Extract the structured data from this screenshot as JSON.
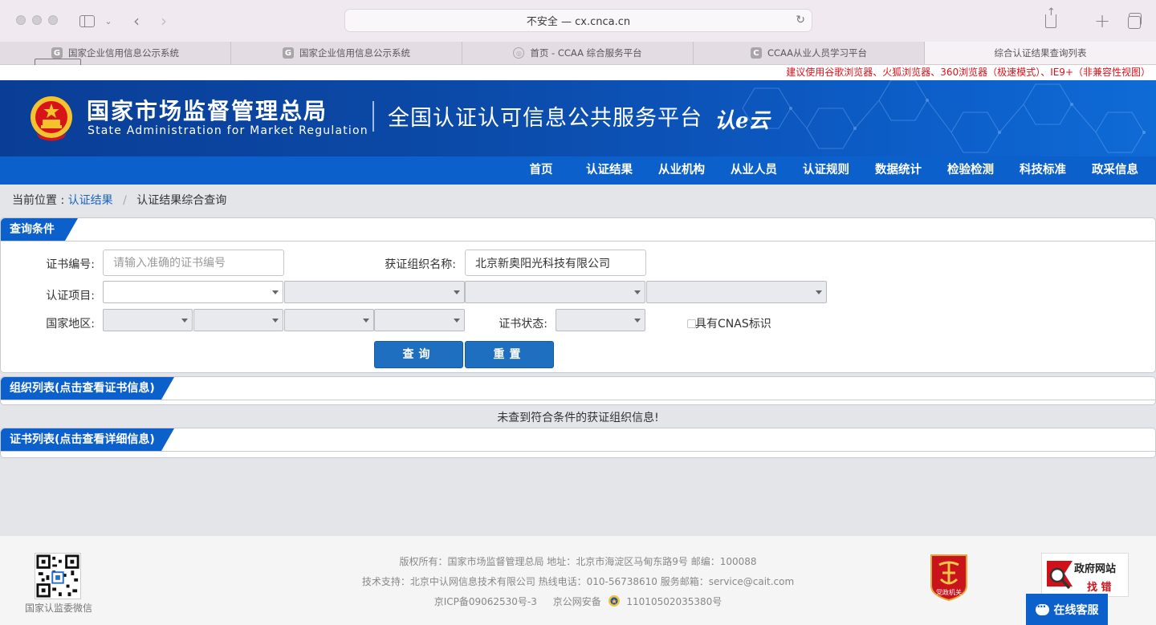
{
  "browser": {
    "address": "不安全 — cx.cnca.cn"
  },
  "tabs": [
    {
      "label": "国家企业信用信息公示系统",
      "favicon": "G",
      "active": false
    },
    {
      "label": "国家企业信用信息公示系统",
      "favicon": "G",
      "active": false
    },
    {
      "label": "首页 - CCAA 综合服务平台",
      "favicon": "ccaa",
      "active": false
    },
    {
      "label": "CCAA从业人员学习平台",
      "favicon": "C",
      "active": false
    },
    {
      "label": "综合认证结果查询列表",
      "favicon": "qr",
      "active": true
    }
  ],
  "notice": "建议使用谷歌浏览器、火狐浏览器、360浏览器（极速模式）、IE9+（非兼容性视图）",
  "header": {
    "org_cn": "国家市场监督管理总局",
    "org_en": "State Administration  for  Market Regulation",
    "platform": "全国认证认可信息公共服务平台",
    "brand": "认e云"
  },
  "nav": [
    "首页",
    "认证结果",
    "从业机构",
    "从业人员",
    "认证规则",
    "数据统计",
    "检验检测",
    "科技标准",
    "政采信息"
  ],
  "breadcrumb": {
    "prefix": "当前位置 :",
    "link": "认证结果",
    "current": "认证结果综合查询"
  },
  "query": {
    "title": "查询条件",
    "cert_no_label": "证书编号:",
    "cert_no_placeholder": "请输入准确的证书编号",
    "org_name_label": "获证组织名称:",
    "org_name_value": "北京新奥阳光科技有限公司",
    "project_label": "认证项目:",
    "region_label": "国家地区:",
    "status_label": "证书状态:",
    "cnas_label": "具有CNAS标识",
    "search_btn": "查询",
    "reset_btn": "重置"
  },
  "org_list": {
    "title": "组织列表(点击查看证书信息)",
    "empty": "未查到符合条件的获证组织信息!"
  },
  "cert_list": {
    "title": "证书列表(点击查看详细信息)"
  },
  "footer": {
    "qr_caption": "国家认监委微信",
    "line1": "版权所有：国家市场监督管理总局    地址：北京市海淀区马甸东路9号    邮编：100088",
    "line2": "技术支持：北京中认网信息技术有限公司    热线电话：010-56738610    服务邮箱：service@cait.com",
    "icp": "京ICP备09062530号-3",
    "police": "京公网安备",
    "police_no": "11010502035380号",
    "badge_text": "党政机关",
    "gov_line1": "政府网站",
    "gov_line2": "找 错",
    "chat": "在线客服"
  },
  "colors": {
    "brand_blue": "#0c60cc",
    "notice_red": "#e0101a"
  }
}
